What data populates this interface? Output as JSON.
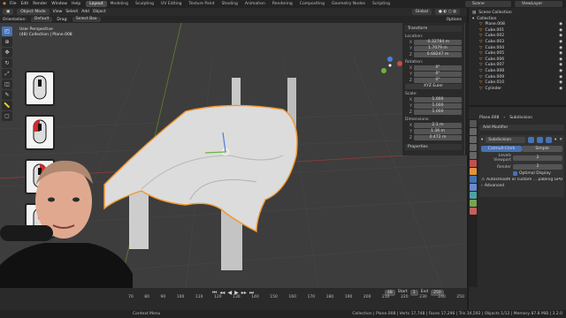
{
  "topbar": {
    "menus": [
      "File",
      "Edit",
      "Render",
      "Window",
      "Help"
    ],
    "workspaces": [
      "Layout",
      "Modeling",
      "Sculpting",
      "UV Editing",
      "Texture Paint",
      "Shading",
      "Animation",
      "Rendering",
      "Compositing",
      "Geometry Nodes",
      "Scripting"
    ],
    "active_workspace": "Layout",
    "scene": "Scene",
    "view_layer": "ViewLayer"
  },
  "viewport_header": {
    "mode": "Object Mode",
    "menus": [
      "View",
      "Select",
      "Add",
      "Object"
    ],
    "shading": "Global"
  },
  "tool_header": {
    "orientation_label": "Orientation:",
    "orientation_value": "Default",
    "drag_label": "Drag:",
    "drag_value": "Select Box",
    "options": "Options"
  },
  "viewport_info": {
    "view": "User Perspective",
    "collection": "(48) Collection | Plane.008"
  },
  "npanel": {
    "title": "Transform",
    "location_label": "Location:",
    "location": [
      "-0.32784 m",
      "1.7079 m",
      "0.68247 m"
    ],
    "rotation_label": "Rotation:",
    "rotation": [
      "0°",
      "0°",
      "0°"
    ],
    "rotation_mode": "XYZ Euler",
    "scale_label": "Scale:",
    "scale": [
      "1.000",
      "1.000",
      "1.000"
    ],
    "dimensions_label": "Dimensions:",
    "dimensions": [
      "2.1 m",
      "1.36 m",
      "0.472 m"
    ],
    "properties": "Properties",
    "axes": [
      "X",
      "Y",
      "Z"
    ]
  },
  "outliner": {
    "title": "Scene Collection",
    "collection": "Collection",
    "items": [
      "Plane.008",
      "Cube.001",
      "Cube.002",
      "Cube.003",
      "Cube.004",
      "Cube.005",
      "Cube.006",
      "Cube.007",
      "Cube.008",
      "Cube.009",
      "Cube.010",
      "Cylinder"
    ]
  },
  "properties": {
    "object_name": "Plane.008",
    "modifier_name": "Subdivision",
    "add_modifier": "Add Modifier",
    "panel_name": "Subdivision",
    "tabs": [
      "Catmull-Clark",
      "Simple"
    ],
    "active_tab": "Catmull-Clark",
    "levels_viewport_label": "Levels Viewport",
    "levels_viewport": "2",
    "render_label": "Render",
    "render": "2",
    "optimal_display": "Optimal Display",
    "gpu_note": "Autosmooth or custom ... pabling GPU subdivision",
    "advanced": "Advanced"
  },
  "timeline": {
    "frames": [
      "70",
      "80",
      "90",
      "100",
      "110",
      "120",
      "130",
      "140",
      "150",
      "160",
      "170",
      "180",
      "190",
      "200",
      "210",
      "220",
      "230",
      "240",
      "250"
    ],
    "start_label": "Start",
    "start": "1",
    "end_label": "End",
    "end": "250",
    "current": "48"
  },
  "status": {
    "left": "Context Menu",
    "stats": "Collection | Plane.008 | Verts 17,748 | Faces 17,296 | Tris 34,592 | Objects 1/12 | Memory 87.8 MiB | 3.2.0"
  },
  "colors": {
    "accent": "#4772b3",
    "selection": "#f29830",
    "viewport_bg": "#3d3d3d"
  }
}
